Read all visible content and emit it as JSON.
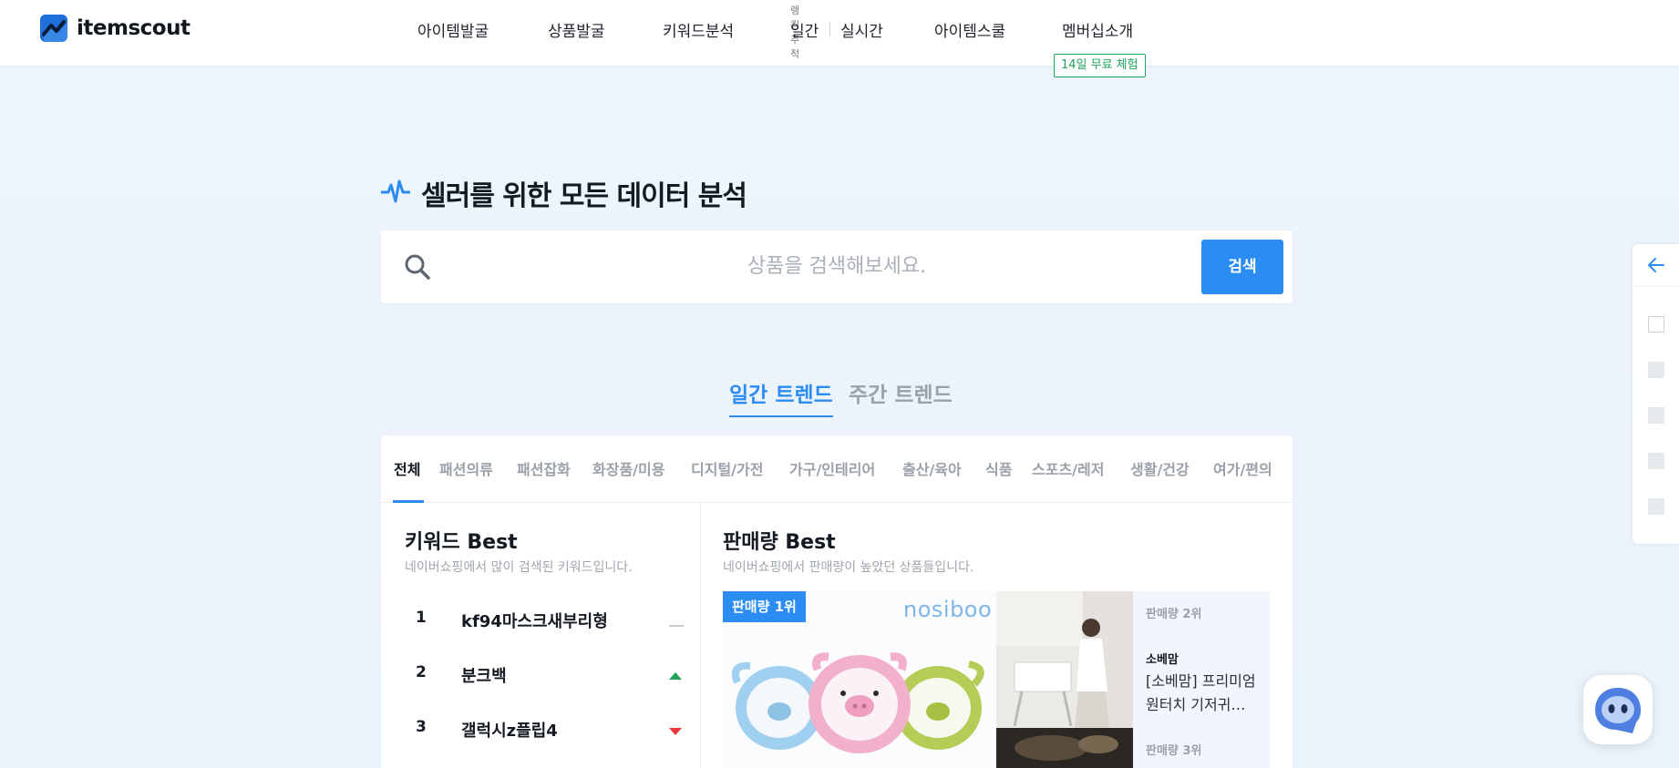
{
  "header": {
    "logo_text": "itemscout",
    "nav": {
      "item_discovery": "아이템발굴",
      "product_discovery": "상품발굴",
      "keyword_analysis": "키워드분석",
      "ranking_label": "랭킹추적",
      "daily": "일간",
      "realtime": "실시간",
      "item_school": "아이템스쿨",
      "membership": "멤버십소개"
    },
    "trial_badge": "14일 무료 체험"
  },
  "hero": {
    "title": "셀러를 위한 모든 데이터 분석",
    "search_placeholder": "상품을 검색해보세요.",
    "search_button": "검색"
  },
  "trend_tabs": {
    "daily": "일간 트렌드",
    "weekly": "주간 트렌드"
  },
  "categories": [
    "전체",
    "패션의류",
    "패션잡화",
    "화장품/미용",
    "디지털/가전",
    "가구/인테리어",
    "출산/육아",
    "식품",
    "스포츠/레저",
    "생활/건강",
    "여가/편의"
  ],
  "keyword_best": {
    "title": "키워드 Best",
    "subtitle": "네이버쇼핑에서 많이 검색된 키워드입니다.",
    "items": [
      {
        "rank": "1",
        "keyword": "kf94마스크새부리형",
        "trend": "same"
      },
      {
        "rank": "2",
        "keyword": "분크백",
        "trend": "up"
      },
      {
        "rank": "3",
        "keyword": "갤럭시z플립4",
        "trend": "down"
      }
    ]
  },
  "sales_best": {
    "title": "판매량 Best",
    "subtitle": "네이버쇼핑에서 판매량이 높았던 상품들입니다.",
    "first": {
      "badge": "판매량 1위",
      "brand_logo": "nosiboo"
    },
    "second": {
      "rank_label": "판매량 2위",
      "brand": "소베맘",
      "name": "[소베맘] 프리미엄 원터치 기저귀…"
    },
    "third": {
      "rank_label": "판매량 3위"
    }
  },
  "colors": {
    "accent": "#2b8cf4",
    "trial_green": "#1fa35b",
    "trend_up": "#1fa35b",
    "trend_down": "#e53935",
    "trend_same": "#c7ccd1"
  },
  "icons": {
    "rail_back": "arrow-left-icon",
    "hero": "pulse-icon",
    "search": "search-icon",
    "chat": "chatbot-icon"
  }
}
